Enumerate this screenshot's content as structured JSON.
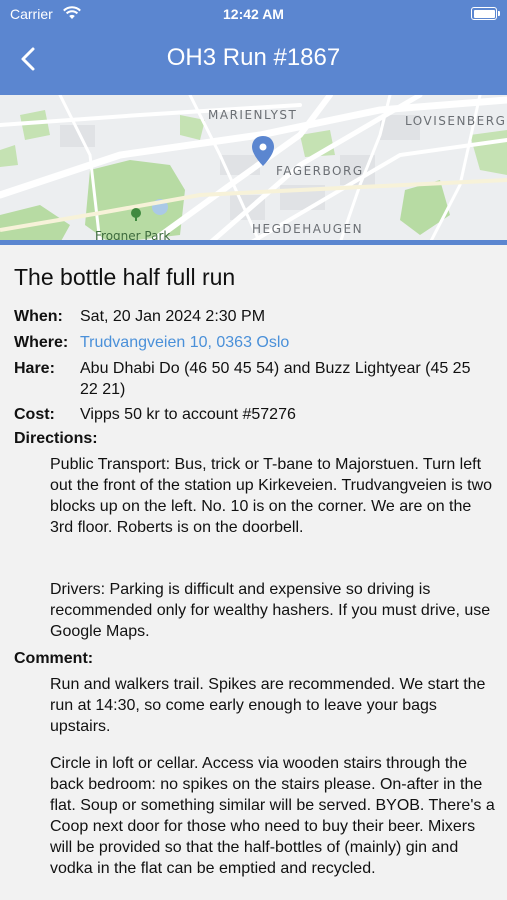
{
  "status": {
    "carrier": "Carrier",
    "time": "12:42 AM"
  },
  "nav": {
    "title": "OH3 Run #1867"
  },
  "map": {
    "labels": [
      "MARIENLYST",
      "LOVISENBERG",
      "FAGERBORG",
      "HEGDEHAUGEN",
      "Frogner Park"
    ]
  },
  "event": {
    "title": "The bottle half full run",
    "when_label": "When:",
    "when": "Sat, 20 Jan 2024 2:30 PM",
    "where_label": "Where:",
    "where": "Trudvangveien 10, 0363 Oslo",
    "hare_label": "Hare:",
    "hare": "Abu Dhabi Do (46 50 45 54) and Buzz Lightyear (45 25 22 21)",
    "cost_label": "Cost:",
    "cost": "Vipps 50 kr to account #57276",
    "directions_label": "Directions:",
    "directions_1": "Public Transport: Bus, trick or T-bane to Majorstuen. Turn left out the front of the station up Kirkeveien. Trudvangveien is two blocks up on the left. No. 10 is on the corner. We are on the 3rd floor. Roberts is on the doorbell.",
    "directions_2": "Drivers: Parking is difficult and expensive so driving is recommended only for wealthy hashers. If you must drive, use Google Maps.",
    "comment_label": "Comment:",
    "comment_1": "Run and walkers trail. Spikes are recommended. We start the run at 14:30, so come early enough to leave your bags upstairs.",
    "comment_2": "Circle in loft or cellar. Access via wooden stairs through the back bedroom: no spikes on the stairs please.  On-after in the flat. Soup or something similar will be served. BYOB. There's a Coop next door for those who need to buy their beer. Mixers will be provided so that the half-bottles of (mainly) gin and vodka in the flat can be emptied and recycled."
  },
  "colors": {
    "nav": "#5b86d0",
    "link": "#4a90d9",
    "pin": "#5b86d0",
    "park": "#b7dba3"
  }
}
